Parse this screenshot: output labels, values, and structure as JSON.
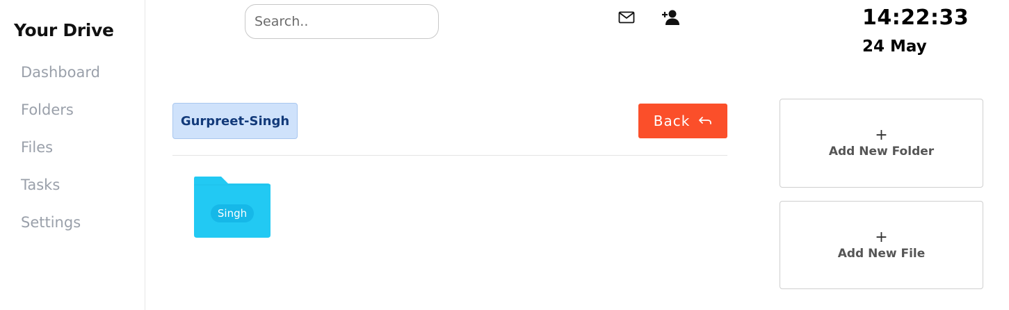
{
  "sidebar": {
    "brand": "Your Drive",
    "items": [
      {
        "label": "Dashboard"
      },
      {
        "label": "Folders"
      },
      {
        "label": "Files"
      },
      {
        "label": "Tasks"
      },
      {
        "label": "Settings"
      }
    ]
  },
  "header": {
    "search_placeholder": "Search..",
    "icons": [
      "mail-icon",
      "add-user-icon"
    ],
    "time": "14:22:33",
    "date": "24 May"
  },
  "main": {
    "breadcrumb": "Gurpreet-Singh",
    "back_label": "Back",
    "back_icon": "undo-arrow-icon",
    "folders": [
      {
        "name": "Singh"
      }
    ]
  },
  "actions": {
    "add_folder": {
      "icon": "+",
      "label": "Add New Folder"
    },
    "add_file": {
      "icon": "+",
      "label": "Add New File"
    }
  },
  "colors": {
    "accent": "#fb4f2a",
    "folder": "#22c9f3",
    "breadcrumb_bg": "#cfe2fb",
    "breadcrumb_text": "#123a7a",
    "nav_text": "#9aa0aa"
  }
}
